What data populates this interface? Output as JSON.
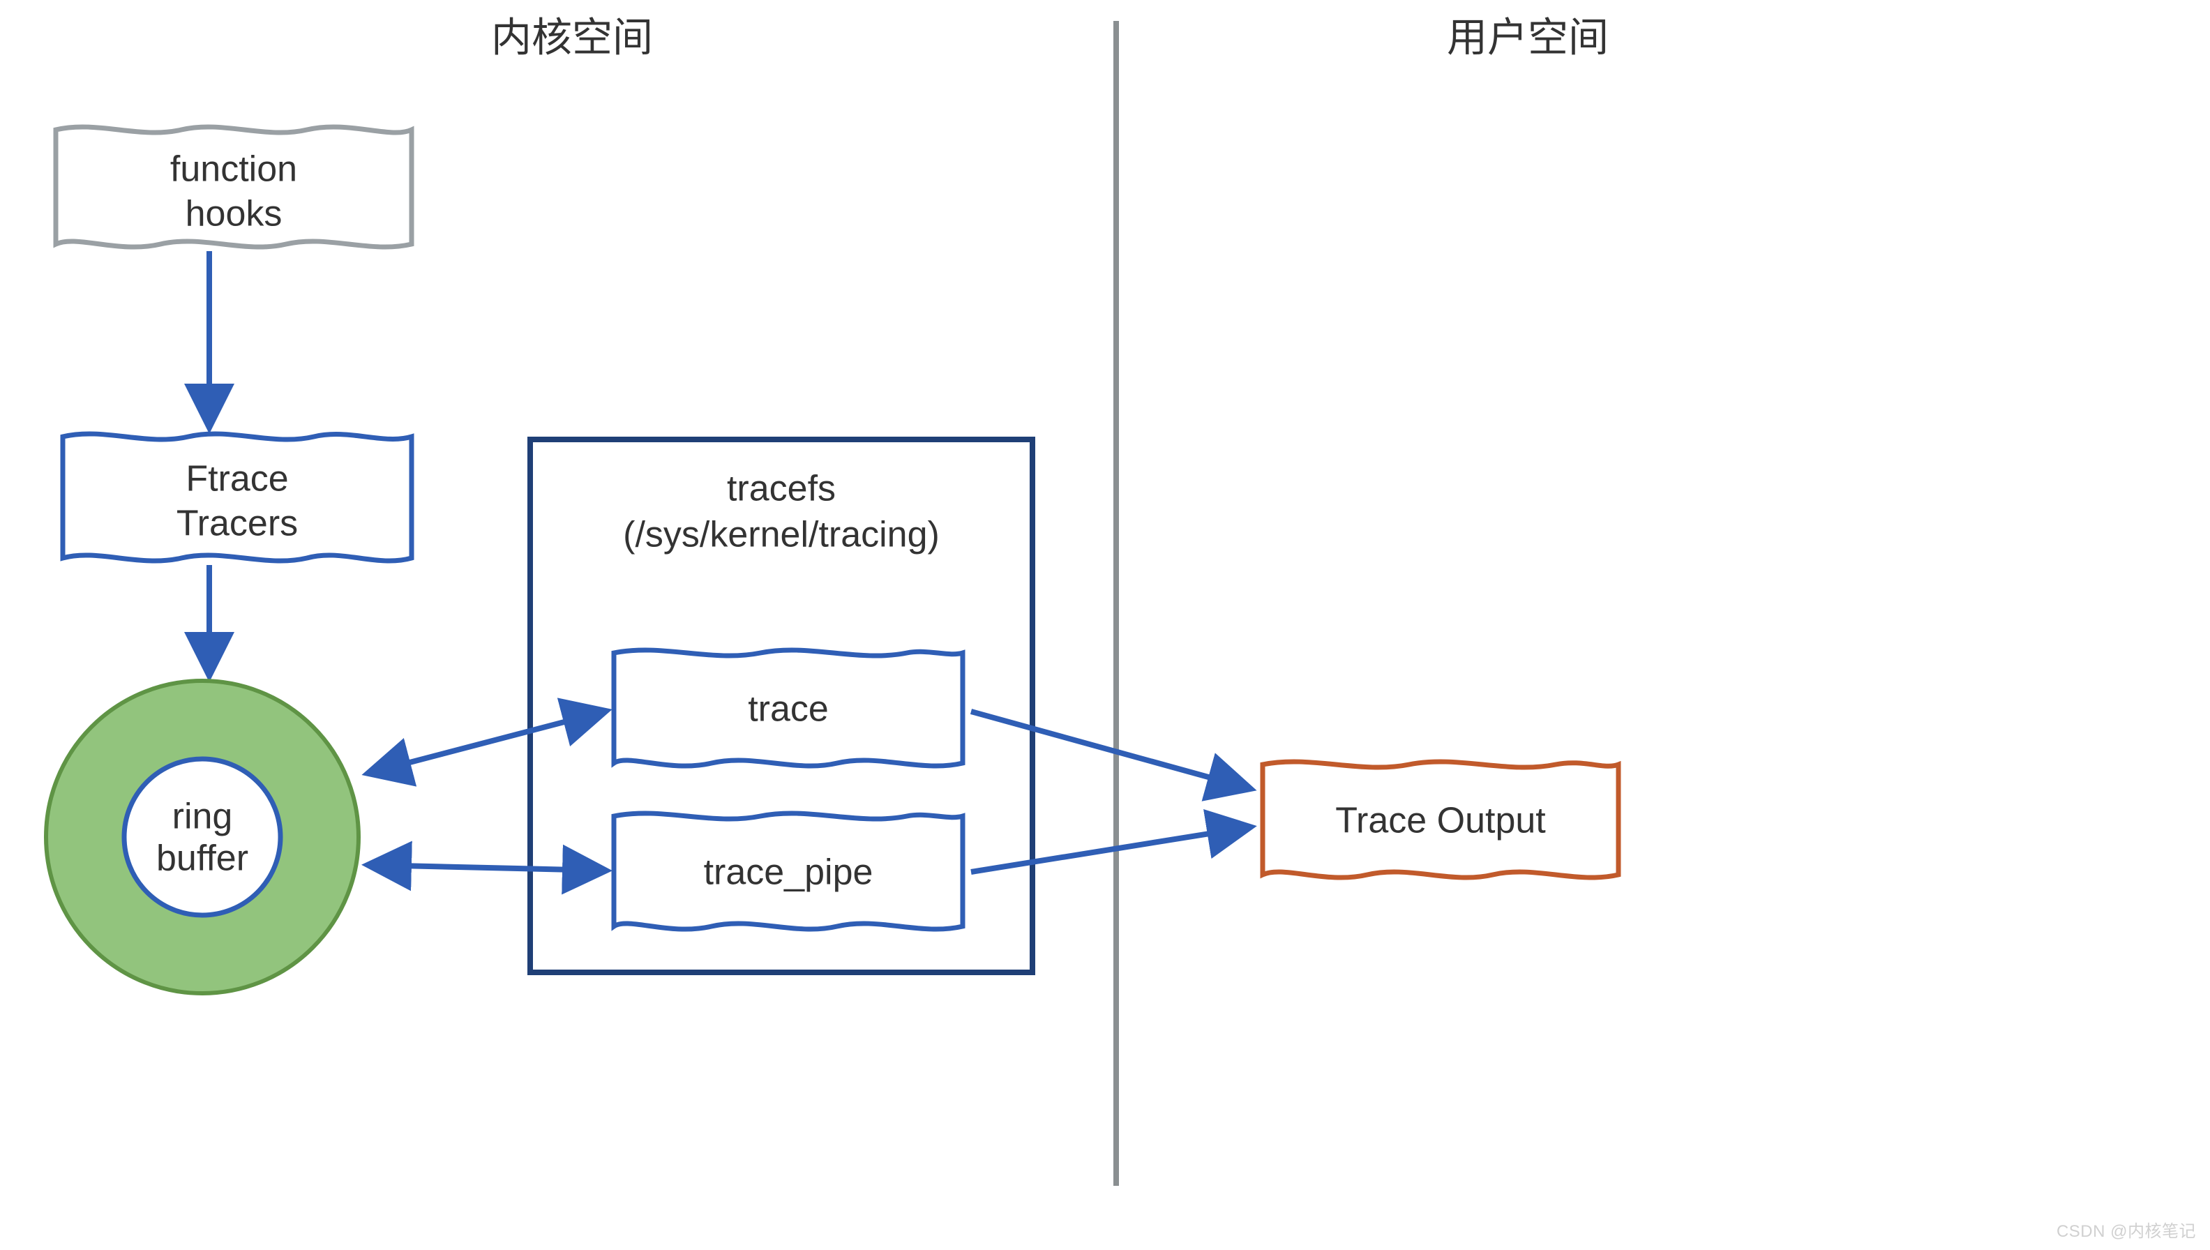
{
  "titles": {
    "kernel_space": "内核空间",
    "user_space": "用户空间"
  },
  "nodes": {
    "function_hooks_l1": "function",
    "function_hooks_l2": "hooks",
    "ftrace_tracers_l1": "Ftrace",
    "ftrace_tracers_l2": "Tracers",
    "ring_buffer_l1": "ring",
    "ring_buffer_l2": "buffer",
    "tracefs_l1": "tracefs",
    "tracefs_l2": "(/sys/kernel/tracing)",
    "trace_file": "trace",
    "trace_pipe_file": "trace_pipe",
    "trace_output": "Trace Output"
  },
  "colors": {
    "blue": "#2f5eb5",
    "darkblue": "#1f3f76",
    "gray": "#9aa0a4",
    "green_fill": "#92c47d",
    "green_stroke": "#5f9445",
    "orange": "#c15a2b",
    "divider": "#8a8f91"
  },
  "watermark": "CSDN @内核笔记"
}
